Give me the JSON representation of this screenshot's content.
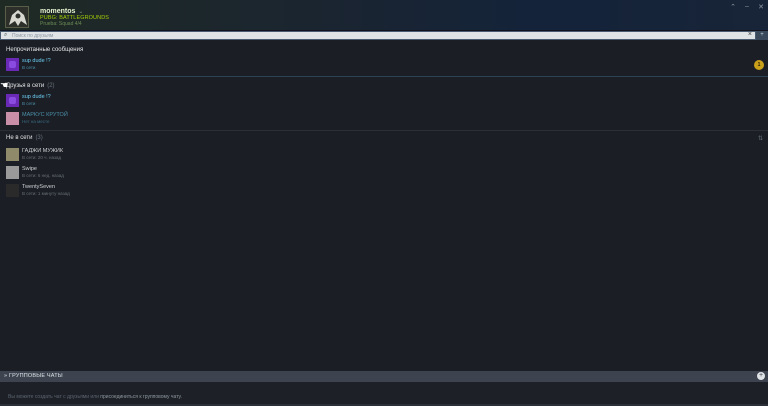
{
  "header": {
    "user_name": "momentos",
    "chevron": "⌄",
    "game_line1": "PUBG: BATTLEGROUNDS",
    "game_line2": "Prueba: Squad 4/4",
    "controls": [
      "⌃",
      "–",
      "✕"
    ]
  },
  "search": {
    "placeholder": "Поиск по друзьям",
    "clear": "×",
    "add_friend": "+"
  },
  "unread": {
    "title": "Непрочитанные сообщения",
    "badge": "1",
    "friends": [
      {
        "name": "sup dude !?",
        "status": "В сети"
      }
    ]
  },
  "online": {
    "title": "Друзья в сети",
    "count": "(2)",
    "friends": [
      {
        "name": "sup dude !?",
        "status": "В сети"
      },
      {
        "name": "МАРКУС КРУТОЙ",
        "status": "Нет на месте"
      }
    ]
  },
  "offline": {
    "title": "Не в сети",
    "count": "(3)",
    "sort": "⇅",
    "friends": [
      {
        "name": "ГАДЖИ МУЖИК",
        "status": "В сети: 20 ч. назад"
      },
      {
        "name": "Swipe",
        "status": "В сети: 6 нед. назад"
      },
      {
        "name": "TwentySeven",
        "status": "В сети: 1 минуту назад"
      }
    ]
  },
  "groups": {
    "label": "» ГРУППОВЫЕ ЧАТЫ",
    "add": "+",
    "hint_prefix": "Вы можете создать чат с друзьями или ",
    "hint_link": "присоединиться к групповому чату."
  }
}
